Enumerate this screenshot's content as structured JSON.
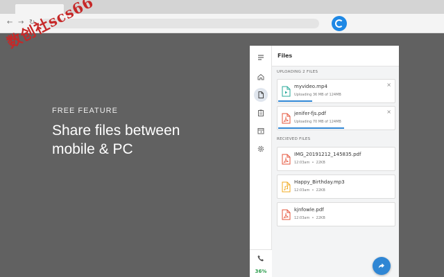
{
  "watermark": "数创社scs66",
  "hero": {
    "kicker": "FREE FEATURE",
    "title": "Share files between mobile & PC"
  },
  "browser": {
    "back_icon": "arrow-left-icon",
    "forward_icon": "arrow-right-icon",
    "reload_icon": "reload-icon",
    "extension_icon": "app-logo-icon"
  },
  "app": {
    "header_title": "Files",
    "battery": "36%",
    "accent_color": "#2f86d4",
    "uploading": {
      "label": "UPLOADING 2 FILES",
      "items": [
        {
          "name": "myvideo.mp4",
          "status": "Uploading 36 MB of 124MB",
          "progress": 0.29,
          "icon": "video-file-icon"
        },
        {
          "name": "jenifer-fjs.pdf",
          "status": "Uploading 70 MB of 124MB",
          "progress": 0.56,
          "icon": "pdf-file-icon"
        }
      ]
    },
    "received": {
      "label": "RECIEVED FILES",
      "items": [
        {
          "name": "IMG_20191212_145835.pdf",
          "time": "12:03am",
          "sep": "•",
          "size": "22KB",
          "icon": "pdf-file-icon"
        },
        {
          "name": "Happy_Birthday.mp3",
          "time": "12:03am",
          "sep": "•",
          "size": "22KB",
          "icon": "audio-file-icon"
        },
        {
          "name": "kjnfowle.pdf",
          "time": "12:03am",
          "sep": "•",
          "size": "22KB",
          "icon": "pdf-file-icon"
        }
      ]
    },
    "rail": [
      "menu-icon",
      "home-icon",
      "files-icon",
      "clipboard-icon",
      "calendar-icon",
      "settings-icon",
      "phone-icon"
    ]
  }
}
